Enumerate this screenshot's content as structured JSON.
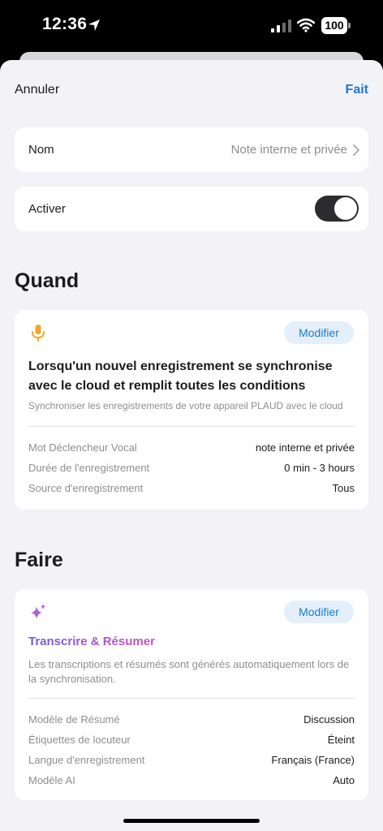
{
  "status_bar": {
    "time": "12:36",
    "battery": "100"
  },
  "nav": {
    "cancel": "Annuler",
    "done": "Fait"
  },
  "name_row": {
    "label": "Nom",
    "value": "Note interne et privée"
  },
  "activate_row": {
    "label": "Activer",
    "enabled": true
  },
  "when": {
    "title": "Quand",
    "icon": "microphone-icon",
    "modify": "Modifier",
    "headline": "Lorsqu'un nouvel enregistrement se synchronise avec le cloud et remplit toutes les conditions",
    "subtitle": "Synchroniser les enregistrements de votre appareil PLAUD avec le cloud",
    "details": [
      {
        "label": "Mot Déclencheur Vocal",
        "value": "note interne et privée"
      },
      {
        "label": "Durée de l'enregistrement",
        "value": "0 min - 3 hours"
      },
      {
        "label": "Source d'enregistrement",
        "value": "Tous"
      }
    ]
  },
  "do": {
    "title": "Faire",
    "icon": "sparkle-icon",
    "modify": "Modifier",
    "action": "Transcrire & Résumer",
    "description": "Les transcriptions et résumés sont générés automatiquement lors de la synchronisation.",
    "details": [
      {
        "label": "Modèle de Résumé",
        "value": "Discussion"
      },
      {
        "label": "Étiquettes de locuteur",
        "value": "Éteint"
      },
      {
        "label": "Langue d'enregistrement",
        "value": "Français (France)"
      },
      {
        "label": "Modèle AI",
        "value": "Auto"
      }
    ]
  },
  "colors": {
    "accent": "#1a7ad6",
    "mic": "#f5a623",
    "toggle_on": "#2c2c2e"
  }
}
